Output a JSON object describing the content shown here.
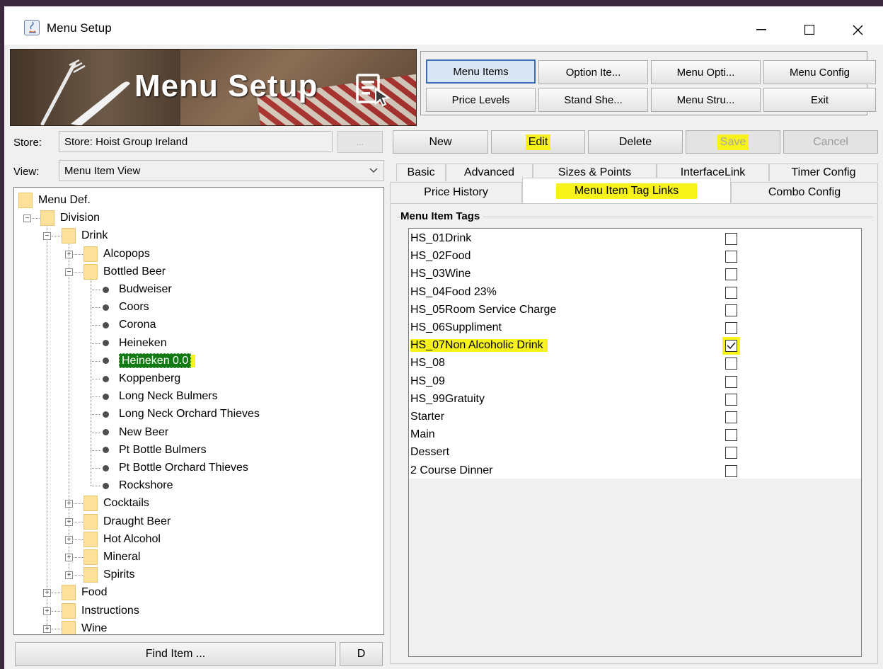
{
  "window": {
    "title": "Menu Setup",
    "controls": {
      "minimize": "—",
      "maximize": "☐",
      "close": "✕"
    }
  },
  "banner": {
    "title": "Menu Setup"
  },
  "nav": {
    "row1": [
      "Menu Items",
      "Option Ite...",
      "Menu Opti...",
      "Menu Config"
    ],
    "row2": [
      "Price Levels",
      "Stand She...",
      "Menu Stru...",
      "Exit"
    ],
    "active": "Menu Items"
  },
  "form": {
    "store_label": "Store:",
    "store_value": "Store: Hoist Group Ireland",
    "browse_label": "...",
    "view_label": "View:",
    "view_value": "Menu Item View"
  },
  "toolbar": {
    "new": "New",
    "edit": "Edit",
    "delete": "Delete",
    "save": "Save",
    "cancel": "Cancel"
  },
  "tabs": {
    "row1": [
      "Basic",
      "Advanced",
      "Sizes & Points",
      "InterfaceLink",
      "Timer Config"
    ],
    "row2": [
      "Price History",
      "Menu Item Tag Links",
      "Combo Config"
    ],
    "selected": "Menu Item Tag Links"
  },
  "tree": {
    "root": "Menu Def.",
    "division": "Division",
    "drink": "Drink",
    "alcopops": "Alcopops",
    "bottled_beer": "Bottled Beer",
    "bottled_items": [
      "Budweiser",
      "Coors",
      "Corona",
      "Heineken",
      "Heineken 0.0",
      "Koppenberg",
      "Long Neck Bulmers",
      "Long Neck Orchard Thieves",
      "New Beer",
      "Pt Bottle Bulmers",
      "Pt Bottle Orchard Thieves",
      "Rockshore"
    ],
    "selected_item": "Heineken 0.0",
    "drink_folders": [
      "Cocktails",
      "Draught Beer",
      "Hot Alcohol",
      "Mineral",
      "Spirits"
    ],
    "division_folders": [
      "Food",
      "Instructions",
      "Wine"
    ]
  },
  "bottom": {
    "find": "Find Item ...",
    "d": "D"
  },
  "tags": {
    "group_title": "Menu Item Tags",
    "items": [
      {
        "label": "HS_01Drink",
        "checked": false
      },
      {
        "label": "HS_02Food",
        "checked": false
      },
      {
        "label": "HS_03Wine",
        "checked": false
      },
      {
        "label": "HS_04Food 23%",
        "checked": false
      },
      {
        "label": "HS_05Room Service Charge",
        "checked": false
      },
      {
        "label": "HS_06Suppliment",
        "checked": false
      },
      {
        "label": "HS_07Non Alcoholic Drink",
        "checked": true
      },
      {
        "label": "HS_08",
        "checked": false
      },
      {
        "label": "HS_09",
        "checked": false
      },
      {
        "label": "HS_99Gratuity",
        "checked": false
      },
      {
        "label": "Starter",
        "checked": false
      },
      {
        "label": "Main",
        "checked": false
      },
      {
        "label": "Dessert",
        "checked": false
      },
      {
        "label": "2 Course Dinner",
        "checked": false
      }
    ]
  },
  "colors": {
    "highlight": "#f7f21a",
    "selection": "#127a12",
    "active_border": "#3b6cb4",
    "folder": "#fce19a"
  }
}
